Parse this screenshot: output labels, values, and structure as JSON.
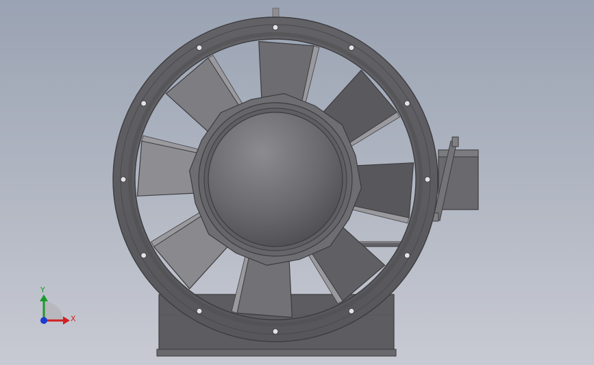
{
  "scene": {
    "subject_icon": "axial-fan-model",
    "background_top": "#9aa3b3",
    "background_bottom": "#c8cad3",
    "body_color": "#5c5c5f",
    "blade_count": 8,
    "bolt_hole_count": 12
  },
  "triad": {
    "x_label": "X",
    "y_label": "Y",
    "x_color": "#d02020",
    "y_color": "#1a9a2a",
    "z_color": "#1a3ad0"
  }
}
